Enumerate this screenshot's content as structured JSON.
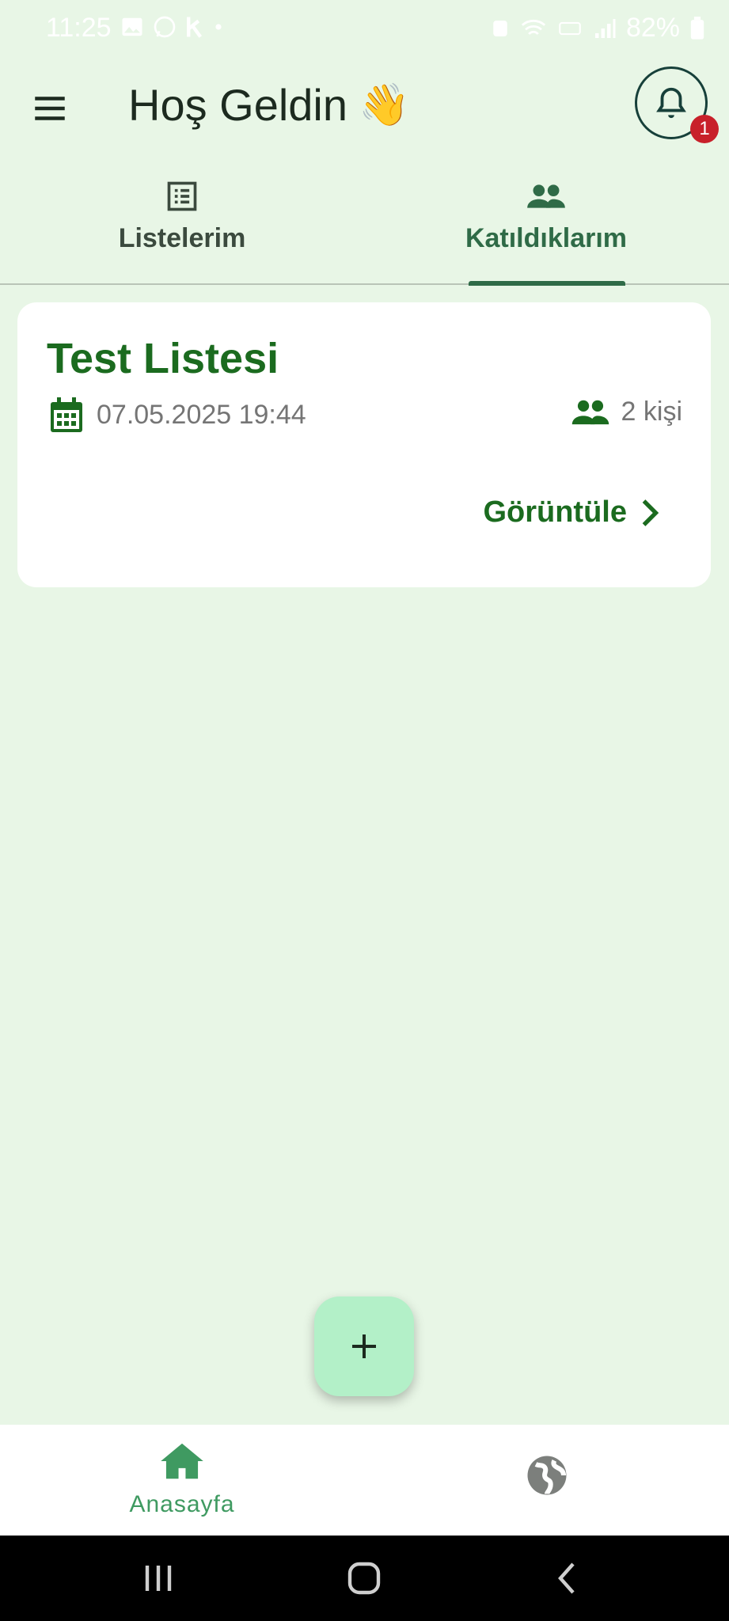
{
  "status_bar": {
    "time": "11:25",
    "battery_percent": "82%"
  },
  "header": {
    "title": "Hoş Geldin",
    "title_emoji": "👋",
    "notification_count": "1"
  },
  "tabs": [
    {
      "label": "Listelerim",
      "icon": "list-icon",
      "selected": false
    },
    {
      "label": "Katıldıklarım",
      "icon": "group-icon",
      "selected": true
    }
  ],
  "card": {
    "title": "Test Listesi",
    "date": "07.05.2025 19:44",
    "people": "2 kişi",
    "view_label": "Görüntüle"
  },
  "fab": {
    "icon": "plus-icon"
  },
  "bottom_nav": {
    "items": [
      {
        "label": "Anasayfa",
        "icon": "home-icon",
        "selected": true
      },
      {
        "label": "",
        "icon": "globe-icon",
        "selected": false
      }
    ]
  },
  "colors": {
    "background": "#e8f6e6",
    "primary_green": "#1b6b1f",
    "tab_selected": "#2f6b47",
    "fab": "#b3f0c8",
    "badge": "#c8202a"
  }
}
